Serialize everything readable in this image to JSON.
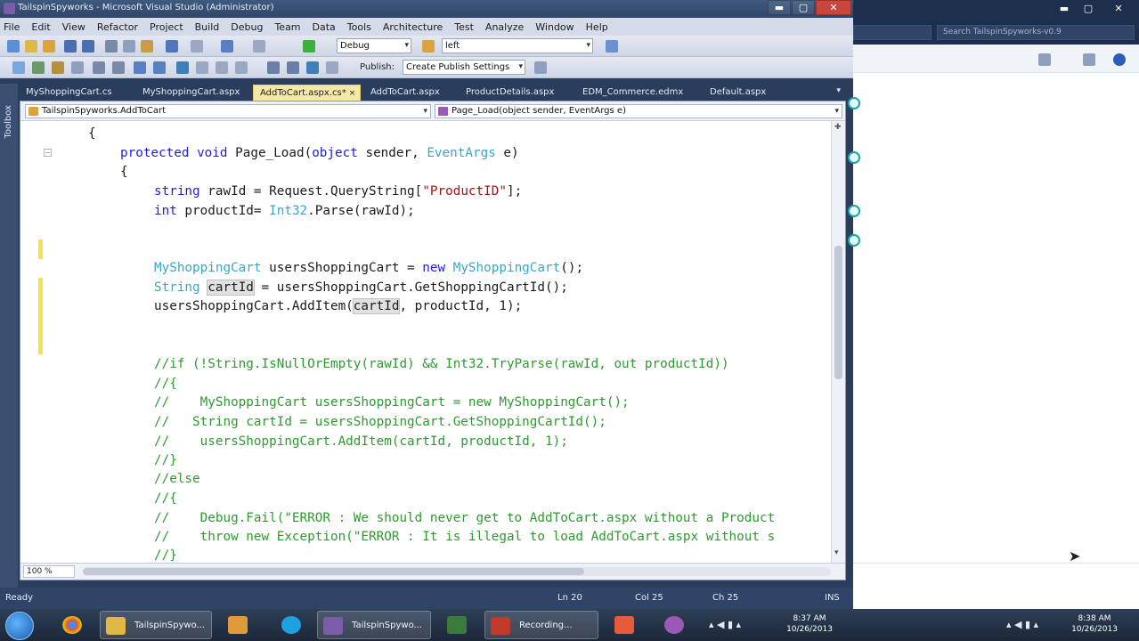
{
  "window": {
    "title": "TailspinSpyworks - Microsoft Visual Studio (Administrator)",
    "minimize": "▬",
    "maximize": "▢",
    "close": "✕"
  },
  "menu": [
    "File",
    "Edit",
    "View",
    "Refactor",
    "Project",
    "Build",
    "Debug",
    "Team",
    "Data",
    "Tools",
    "Architecture",
    "Test",
    "Analyze",
    "Window",
    "Help"
  ],
  "toolbar": {
    "config": "Debug",
    "find": "left",
    "publish_label": "Publish:",
    "publish_setting": "Create Publish Settings"
  },
  "tabs": [
    {
      "label": "MyShoppingCart.cs",
      "active": false
    },
    {
      "label": "MyShoppingCart.aspx",
      "active": false
    },
    {
      "label": "AddToCart.aspx.cs*",
      "active": true
    },
    {
      "label": "AddToCart.aspx",
      "active": false
    },
    {
      "label": "ProductDetails.aspx",
      "active": false
    },
    {
      "label": "EDM_Commerce.edmx",
      "active": false
    },
    {
      "label": "Default.aspx",
      "active": false
    }
  ],
  "tab_close": "×",
  "tab_overflow": "▾",
  "toolbox_label": "Toolbox",
  "navbar": {
    "type_combo": "TailspinSpyworks.AddToCart",
    "member_combo": "Page_Load(object sender, EventArgs e)"
  },
  "code_lines": [
    "{",
    "protected void Page_Load(object sender, EventArgs e)",
    "{",
    "string rawId = Request.QueryString[\"ProductID\"];",
    "int productId= Int32.Parse(rawId);",
    "",
    "",
    "MyShoppingCart usersShoppingCart = new MyShoppingCart();",
    "String cartId = usersShoppingCart.GetShoppingCartId();",
    "usersShoppingCart.AddItem(cartId, productId, 1);",
    "",
    "",
    "//if (!String.IsNullOrEmpty(rawId) && Int32.TryParse(rawId, out productId))",
    "//{",
    "//    MyShoppingCart usersShoppingCart = new MyShoppingCart();",
    "//   String cartId = usersShoppingCart.GetShoppingCartId();",
    "//    usersShoppingCart.AddItem(cartId, productId, 1);",
    "//}",
    "//else",
    "//{",
    "//    Debug.Fail(\"ERROR : We should never get to AddToCart.aspx without a Product",
    "//    throw new Exception(\"ERROR : It is illegal to load AddToCart.aspx without s",
    "//}"
  ],
  "zoom": "100 %",
  "status": {
    "state": "Ready",
    "ln": "Ln 20",
    "col": "Col 25",
    "ch": "Ch 25",
    "mode": "INS"
  },
  "right_window": {
    "search_placeholder": "Search TailspinSpyworks-v0.9"
  },
  "taskbar": {
    "items": [
      "TailspinSpywo...",
      "TailspinSpywo...",
      "Recording..."
    ],
    "clock_left": {
      "time": "8:37 AM",
      "date": "10/26/2013"
    },
    "clock_right": {
      "time": "8:38 AM",
      "date": "10/26/2013"
    }
  },
  "colors": {
    "keyword": "#1f1fd6",
    "type": "#3aa6c7",
    "string": "#a31515",
    "comment": "#2f9a2f",
    "active_tab": "#f6e8a6"
  }
}
